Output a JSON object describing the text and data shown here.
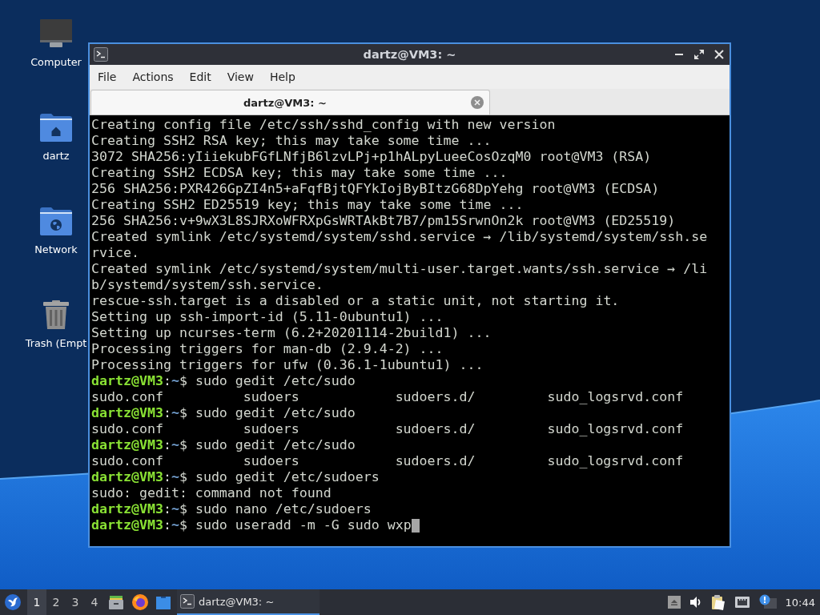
{
  "desktop_icons": [
    {
      "kind": "computer",
      "label": "Computer"
    },
    {
      "kind": "home_folder",
      "label": "dartz"
    },
    {
      "kind": "network_folder",
      "label": "Network"
    },
    {
      "kind": "trash",
      "label": "Trash (Empt"
    }
  ],
  "window": {
    "title": "dartz@VM3: ~",
    "menu": [
      "File",
      "Actions",
      "Edit",
      "View",
      "Help"
    ],
    "tabs": [
      {
        "label": "dartz@VM3: ~",
        "selected": true
      }
    ],
    "terminal": {
      "lines": [
        {
          "kind": "output",
          "text": "Creating config file /etc/ssh/sshd_config with new version"
        },
        {
          "kind": "output",
          "text": "Creating SSH2 RSA key; this may take some time ..."
        },
        {
          "kind": "output",
          "text": "3072 SHA256:yIiiekubFGfLNfjB6lzvLPj+p1hALpyLueeCosOzqM0 root@VM3 (RSA)"
        },
        {
          "kind": "output",
          "text": "Creating SSH2 ECDSA key; this may take some time ..."
        },
        {
          "kind": "output",
          "text": "256 SHA256:PXR426GpZI4n5+aFqfBjtQFYkIojByBItzG68DpYehg root@VM3 (ECDSA)"
        },
        {
          "kind": "output",
          "text": "Creating SSH2 ED25519 key; this may take some time ..."
        },
        {
          "kind": "output",
          "text": "256 SHA256:v+9wX3L8SJRXoWFRXpGsWRTAkBt7B7/pm15SrwnOn2k root@VM3 (ED25519)"
        },
        {
          "kind": "output",
          "text": "Created symlink /etc/systemd/system/sshd.service → /lib/systemd/system/ssh.se"
        },
        {
          "kind": "output",
          "text": "rvice."
        },
        {
          "kind": "output",
          "text": "Created symlink /etc/systemd/system/multi-user.target.wants/ssh.service → /li"
        },
        {
          "kind": "output",
          "text": "b/systemd/system/ssh.service."
        },
        {
          "kind": "output",
          "text": "rescue-ssh.target is a disabled or a static unit, not starting it."
        },
        {
          "kind": "output",
          "text": "Setting up ssh-import-id (5.11-0ubuntu1) ..."
        },
        {
          "kind": "output",
          "text": "Setting up ncurses-term (6.2+20201114-2build1) ..."
        },
        {
          "kind": "output",
          "text": "Processing triggers for man-db (2.9.4-2) ..."
        },
        {
          "kind": "output",
          "text": "Processing triggers for ufw (0.36.1-1ubuntu1) ..."
        },
        {
          "kind": "prompt",
          "user_host": "dartz@VM3",
          "separator": ":",
          "path": "~",
          "input": "$ sudo gedit /etc/sudo",
          "cursor": false
        },
        {
          "kind": "completions",
          "items": [
            "sudo.conf",
            "sudoers",
            "sudoers.d/",
            "sudo_logsrvd.conf"
          ]
        },
        {
          "kind": "prompt",
          "user_host": "dartz@VM3",
          "separator": ":",
          "path": "~",
          "input": "$ sudo gedit /etc/sudo",
          "cursor": false
        },
        {
          "kind": "completions",
          "items": [
            "sudo.conf",
            "sudoers",
            "sudoers.d/",
            "sudo_logsrvd.conf"
          ]
        },
        {
          "kind": "prompt",
          "user_host": "dartz@VM3",
          "separator": ":",
          "path": "~",
          "input": "$ sudo gedit /etc/sudo",
          "cursor": false
        },
        {
          "kind": "completions",
          "items": [
            "sudo.conf",
            "sudoers",
            "sudoers.d/",
            "sudo_logsrvd.conf"
          ]
        },
        {
          "kind": "prompt",
          "user_host": "dartz@VM3",
          "separator": ":",
          "path": "~",
          "input": "$ sudo gedit /etc/sudoers",
          "cursor": false
        },
        {
          "kind": "output",
          "text": "sudo: gedit: command not found"
        },
        {
          "kind": "prompt",
          "user_host": "dartz@VM3",
          "separator": ":",
          "path": "~",
          "input": "$ sudo nano /etc/sudoers",
          "cursor": false
        },
        {
          "kind": "prompt",
          "user_host": "dartz@VM3",
          "separator": ":",
          "path": "~",
          "input": "$ sudo useradd -m -G sudo wxp",
          "cursor": true
        }
      ]
    }
  },
  "taskbar": {
    "workspaces": [
      {
        "label": "1",
        "selected": true
      },
      {
        "label": "2",
        "selected": false
      },
      {
        "label": "3",
        "selected": false
      },
      {
        "label": "4",
        "selected": false
      }
    ],
    "tasks": [
      {
        "label": "dartz@VM3: ~",
        "selected": true
      }
    ],
    "clock": "10:44"
  }
}
